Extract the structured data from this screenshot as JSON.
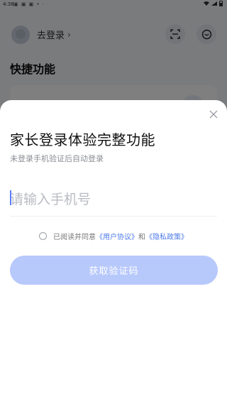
{
  "status_bar": {
    "time": "4:38",
    "left_icons": "▣ ▣ ▣ • ·"
  },
  "header": {
    "login_label": "去登录",
    "chevron": "›",
    "icons": [
      "avatar",
      "scan-icon",
      "message-icon"
    ]
  },
  "section": {
    "title": "快捷功能"
  },
  "sheet": {
    "title": "家长登录体验完整功能",
    "subtitle": "未登录手机验证后自动登录",
    "phone_placeholder": "请输入手机号",
    "agreement": {
      "prefix": "已阅读并同意",
      "user_agreement": "《用户协议》",
      "and": "和",
      "privacy_policy": "《隐私政策》"
    },
    "submit_label": "获取验证码",
    "colors": {
      "button": "#b7c8fb",
      "link": "#4c79e8",
      "caret": "#5b7cff"
    }
  }
}
